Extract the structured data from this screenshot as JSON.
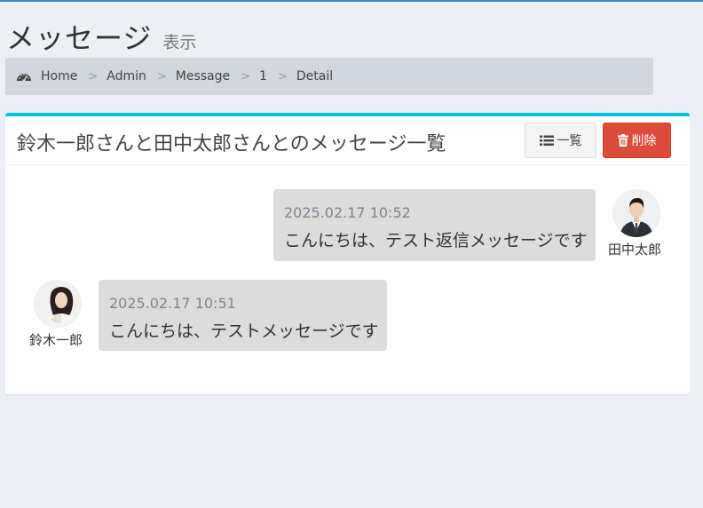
{
  "header": {
    "title": "メッセージ",
    "subtitle": "表示"
  },
  "breadcrumb": {
    "icon": "dashboard-icon",
    "items": [
      "Home",
      "Admin",
      "Message",
      "1",
      "Detail"
    ],
    "separator": ">"
  },
  "box": {
    "title": "鈴木一郎さんと田中太郎さんとのメッセージ一覧",
    "accent_color": "#00c0ef",
    "buttons": {
      "list": {
        "label": "一覧",
        "icon": "list-icon"
      },
      "delete": {
        "label": "削除",
        "icon": "trash-icon",
        "color": "#dd4b39"
      }
    }
  },
  "messages": [
    {
      "sender": "田中太郎",
      "time": "2025.02.17 10:52",
      "text": "こんにちは、テスト返信メッセージです",
      "side": "right"
    },
    {
      "sender": "鈴木一郎",
      "time": "2025.02.17 10:51",
      "text": "こんにちは、テストメッセージです",
      "side": "left"
    }
  ]
}
